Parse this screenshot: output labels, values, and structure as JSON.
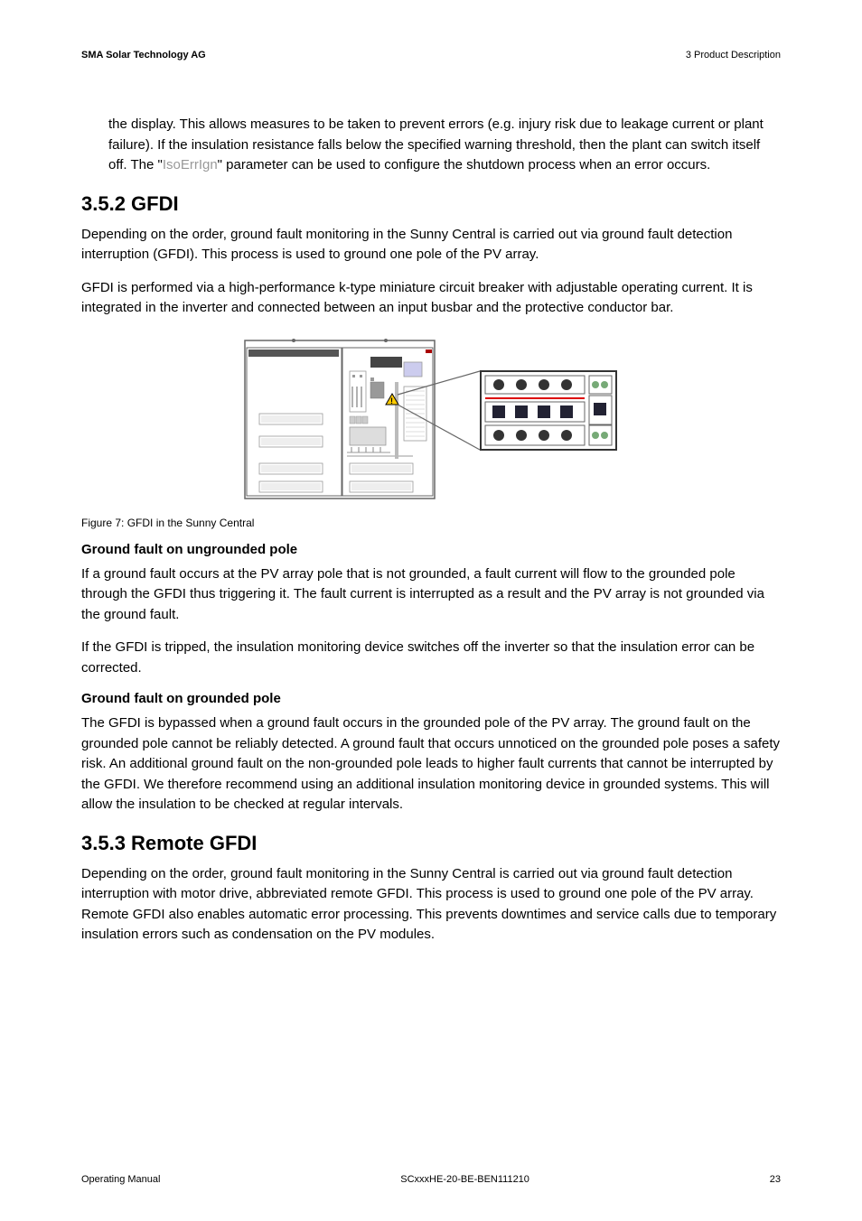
{
  "header": {
    "left": "SMA Solar Technology AG",
    "right": "3  Product Description"
  },
  "intro_paragraph": {
    "pre": "the display. This allows measures to be taken to prevent errors (e.g. injury risk due to leakage current or plant failure). If the insulation resistance falls below the specified warning threshold, then the plant can switch itself off. The \"",
    "param": "IsoErrIgn",
    "post": "\" parameter can be used to configure the shutdown process when an error occurs."
  },
  "section_352": {
    "heading": "3.5.2  GFDI",
    "paragraph1": "Depending on the order, ground fault monitoring in the Sunny Central is carried out via ground fault detection interruption (GFDI). This process is used to ground one pole of the PV array.",
    "paragraph2": "GFDI is performed via a high-performance k-type miniature circuit breaker with adjustable operating current. It is integrated in the inverter and connected between an input busbar and the protective conductor bar.",
    "figure_caption": "Figure 7:    GFDI in the Sunny Central",
    "sub1_heading": "Ground fault on ungrounded pole",
    "sub1_p1": "If a ground fault occurs at the PV array pole that is not grounded, a fault current will flow to the grounded pole through the GFDI thus triggering it. The fault current is interrupted as a result and the PV array is not grounded via the ground fault.",
    "sub1_p2": "If the GFDI is tripped, the insulation monitoring device switches off the inverter so that the insulation error can be corrected.",
    "sub2_heading": "Ground fault on grounded pole",
    "sub2_p1": "The GFDI is bypassed when a ground fault occurs in the grounded pole of the PV array. The ground fault on the grounded pole cannot be reliably detected. A ground fault that occurs unnoticed on the grounded pole poses a safety risk. An additional ground fault on the non-grounded pole leads to higher fault currents that cannot be interrupted by the GFDI. We therefore recommend using an additional insulation monitoring device in grounded systems. This will allow the insulation to be checked at regular intervals."
  },
  "section_353": {
    "heading": "3.5.3  Remote GFDI",
    "paragraph1": "Depending on the order, ground fault monitoring in the Sunny Central is carried out via ground fault detection interruption with motor drive, abbreviated remote GFDI. This process is used to ground one pole of the PV array. Remote GFDI also enables automatic error processing. This prevents downtimes and service calls due to temporary insulation errors such as condensation on the PV modules."
  },
  "footer": {
    "left": "Operating Manual",
    "center": "SCxxxHE-20-BE-BEN111210",
    "right": "23"
  }
}
